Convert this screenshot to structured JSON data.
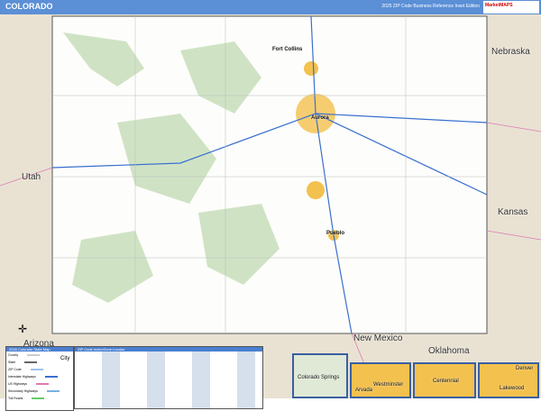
{
  "header": {
    "title": "COLORADO",
    "edition": "2025 ZIP Code Business Reference Inset Edition",
    "logo": "MarketMAPS"
  },
  "states": [
    "Nebraska",
    "Utah",
    "Kansas",
    "Arizona",
    "New Mexico",
    "Oklahoma"
  ],
  "cities": [
    "Fort Collins",
    "Aurora",
    "Pueblo"
  ],
  "legend": {
    "title": "2025 Colorado State Map",
    "items": [
      "County",
      "State",
      "ZIP Code",
      "Interstate Highways",
      "US Highways",
      "Secondary Highways",
      "Toll Roads"
    ],
    "city_label": "City"
  },
  "index": {
    "title": "ZIP Code Index/Zone Locator"
  },
  "insets": [
    "Colorado Springs",
    "Arvada",
    "Westminster",
    "Centennial",
    "Denver",
    "Lakewood"
  ],
  "colors": {
    "header": "#5b8fd6",
    "land": "#e9e2d3",
    "state": "#ffffff",
    "forest": "#cfe3c4",
    "urban": "#f3c14e"
  }
}
